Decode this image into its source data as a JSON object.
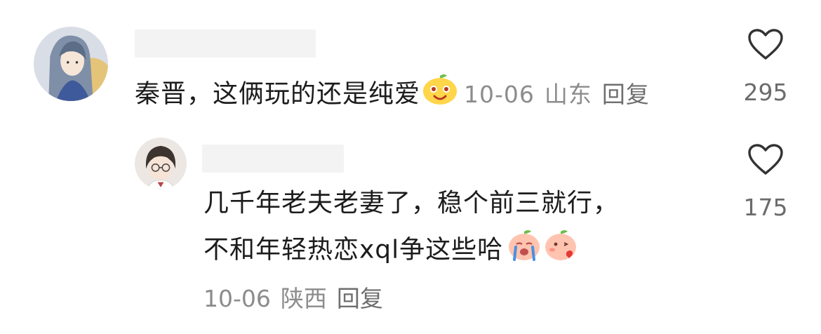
{
  "comments": [
    {
      "text": "秦晋，这俩玩的还是纯爱",
      "emoji": "smiling-peach-emoji",
      "date": "10-06",
      "location": "山东",
      "reply_label": "回复",
      "likes": "295",
      "avatar": "long-haired-character-avatar"
    },
    {
      "line1": "几千年老夫老妻了，稳个前三就行，",
      "line2": "不和年轻热恋xql争这些哈",
      "emojis": [
        "crying-peach-emoji",
        "blushing-peach-emoji"
      ],
      "date": "10-06",
      "location": "陕西",
      "reply_label": "回复",
      "likes": "175",
      "avatar": "glasses-boy-avatar"
    }
  ],
  "colors": {
    "text": "#1c1c1c",
    "meta": "#8c8c8c",
    "heart_outline": "#333333"
  }
}
